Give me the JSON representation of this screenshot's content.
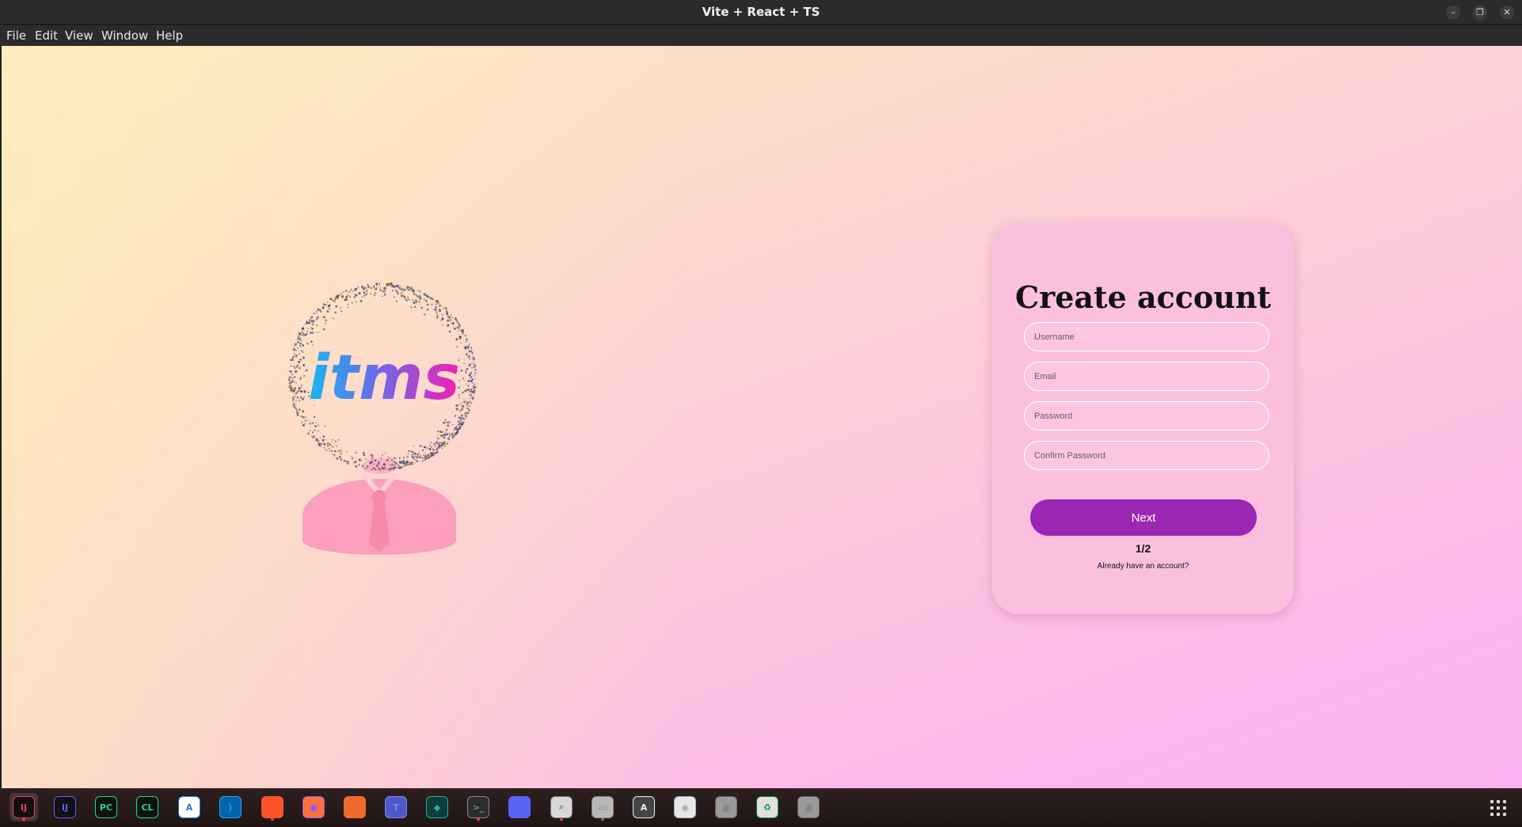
{
  "window": {
    "title": "Vite + React + TS",
    "controls": [
      "minimize",
      "restore",
      "close"
    ]
  },
  "menu": [
    "File",
    "Edit",
    "View",
    "Window",
    "Help"
  ],
  "logo": {
    "text": "itms"
  },
  "form": {
    "title": "Create account",
    "fields": [
      {
        "name": "username",
        "placeholder": "Username",
        "value": ""
      },
      {
        "name": "email",
        "placeholder": "Email",
        "value": ""
      },
      {
        "name": "password",
        "placeholder": "Password",
        "value": ""
      },
      {
        "name": "confirm_password",
        "placeholder": "Confirm Password",
        "value": ""
      }
    ],
    "next_label": "Next",
    "step": "1/2",
    "signin_link": "Already have an account?"
  },
  "colors": {
    "accent": "#9b27b2",
    "card": "#fbc0df",
    "gradient_left": "#fdeec0",
    "gradient_right": "#fab2f2"
  },
  "taskbar": {
    "apps": [
      "intellij-idea-icon",
      "intellij-idea-alt-icon",
      "pycharm-icon",
      "clion-icon",
      "app-store-icon",
      "vscode-icon",
      "brave-icon",
      "firefox-icon",
      "paintbrush-icon",
      "teams-icon",
      "gitkraken-icon",
      "terminal-icon",
      "discord-icon",
      "image-viewer-icon",
      "files-icon",
      "software-center-icon",
      "disc-icon",
      "drive-icon",
      "trash-icon",
      "drive-2-icon"
    ],
    "app_grid": "app-grid-icon"
  }
}
